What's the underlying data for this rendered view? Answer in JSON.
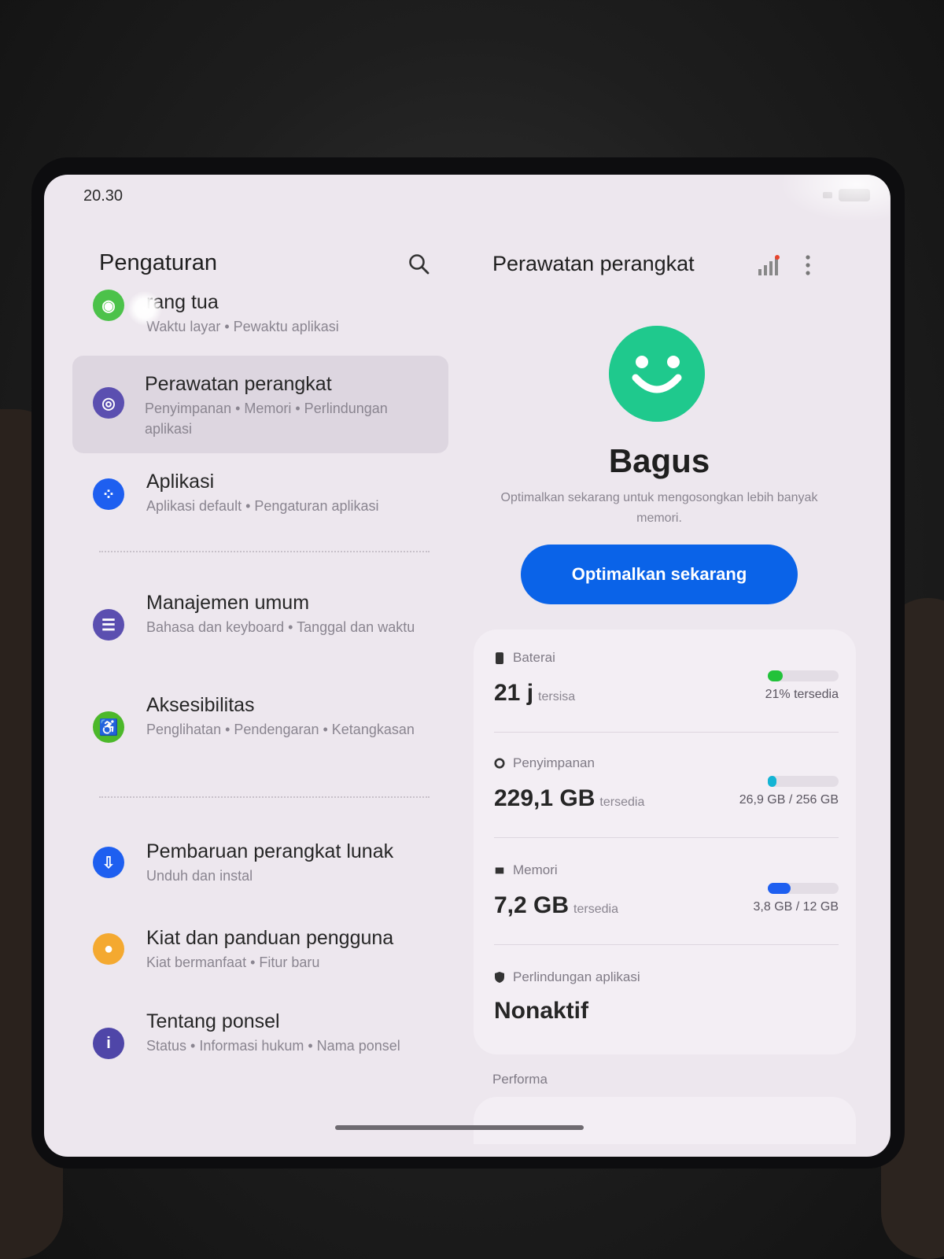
{
  "status_bar": {
    "time": "20.30"
  },
  "settings": {
    "title": "Pengaturan",
    "items": [
      {
        "title": "rang tua",
        "subtitle": "Waktu layar  •  Pewaktu aplikasi",
        "icon": "parental-icon",
        "color": "#4cc24a"
      },
      {
        "title": "Perawatan perangkat",
        "subtitle": "Penyimpanan  •  Memori  •  Perlindungan aplikasi",
        "icon": "device-care-icon",
        "color": "#5b4fb0",
        "selected": true
      },
      {
        "title": "Aplikasi",
        "subtitle": "Aplikasi default  •  Pengaturan aplikasi",
        "icon": "apps-icon",
        "color": "#1e5ff0"
      },
      {
        "title": "Manajemen umum",
        "subtitle": "Bahasa dan keyboard  •  Tanggal dan waktu",
        "icon": "sliders-icon",
        "color": "#5b4fb0"
      },
      {
        "title": "Aksesibilitas",
        "subtitle": "Penglihatan  •  Pendengaran  •  Ketangkasan",
        "icon": "accessibility-icon",
        "color": "#4cb82a"
      },
      {
        "title": "Pembaruan perangkat lunak",
        "subtitle": "Unduh dan instal",
        "icon": "download-icon",
        "color": "#1e5ff0"
      },
      {
        "title": "Kiat dan panduan pengguna",
        "subtitle": "Kiat bermanfaat  •  Fitur baru",
        "icon": "lightbulb-icon",
        "color": "#f4a930"
      },
      {
        "title": "Tentang ponsel",
        "subtitle": "Status  •  Informasi hukum  •  Nama ponsel",
        "icon": "info-icon",
        "color": "#4f46a8"
      }
    ]
  },
  "device_care": {
    "title": "Perawatan perangkat",
    "status": "Bagus",
    "description": "Optimalkan sekarang untuk mengosongkan lebih banyak memori.",
    "optimize_label": "Optimalkan sekarang",
    "battery": {
      "label": "Baterai",
      "value": "21 j",
      "suffix": "tersisa",
      "info": "21% tersedia",
      "level": 0.21,
      "color": "#22c23a"
    },
    "storage": {
      "label": "Penyimpanan",
      "value": "229,1 GB",
      "suffix": "tersedia",
      "info": "26,9 GB / 256 GB",
      "level": 0.105,
      "color": "#14b4d4"
    },
    "memory": {
      "label": "Memori",
      "value": "7,2 GB",
      "suffix": "tersedia",
      "info": "3,8 GB / 12 GB",
      "level": 0.32,
      "color": "#1e5ff0"
    },
    "protection": {
      "label": "Perlindungan aplikasi",
      "value": "Nonaktif"
    },
    "performance_label": "Performa"
  }
}
